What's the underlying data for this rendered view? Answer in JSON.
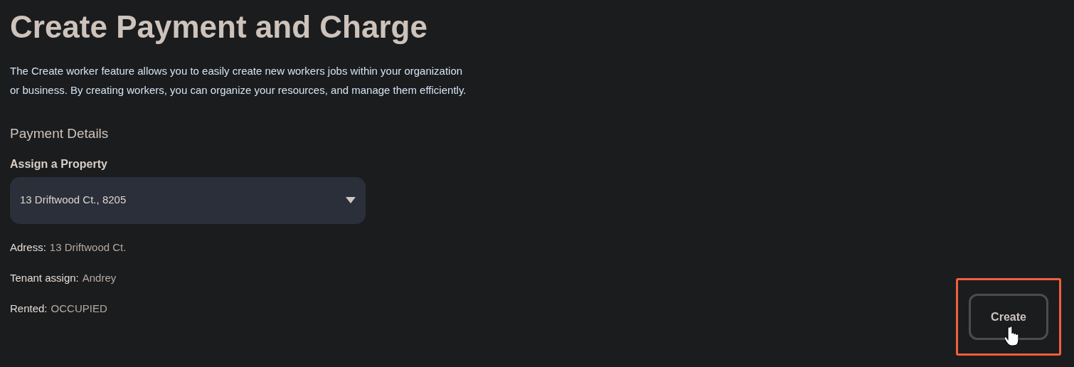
{
  "title": "Create Payment and Charge",
  "description": "The Create worker feature allows you to easily create new workers jobs within your organization or business. By creating workers, you can organize your resources, and manage them efficiently.",
  "section_heading": "Payment Details",
  "property_select": {
    "label": "Assign a Property",
    "value": "13 Driftwood Ct., 8205"
  },
  "details": [
    {
      "label": "Adress:",
      "value": "13 Driftwood Ct."
    },
    {
      "label": "Tenant assign:",
      "value": "Andrey"
    },
    {
      "label": "Rented:",
      "value": "OCCUPIED"
    }
  ],
  "create_button": {
    "label": "Create"
  }
}
